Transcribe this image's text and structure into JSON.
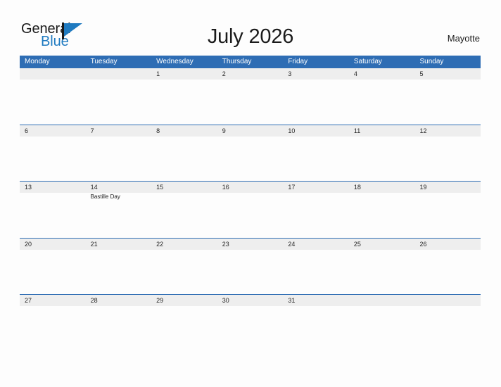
{
  "brand": {
    "name_part1": "General",
    "name_part2": "Blue",
    "flag_icon": "flag-icon",
    "color_primary": "#1f7ac0",
    "color_text": "#1b1b1b"
  },
  "header": {
    "title": "July 2026",
    "location": "Mayotte"
  },
  "theme": {
    "header_blue": "#2e6db4",
    "band_gray": "#eeeeee",
    "page_bg": "#fdfdfd",
    "text_dark": "#262626"
  },
  "calendar": {
    "month": "July",
    "year": "2026",
    "week_start": "Monday",
    "weekdays": [
      "Monday",
      "Tuesday",
      "Wednesday",
      "Thursday",
      "Friday",
      "Saturday",
      "Sunday"
    ],
    "weeks": [
      {
        "days": [
          {
            "num": "",
            "events": []
          },
          {
            "num": "",
            "events": []
          },
          {
            "num": "1",
            "events": []
          },
          {
            "num": "2",
            "events": []
          },
          {
            "num": "3",
            "events": []
          },
          {
            "num": "4",
            "events": []
          },
          {
            "num": "5",
            "events": []
          }
        ]
      },
      {
        "days": [
          {
            "num": "6",
            "events": []
          },
          {
            "num": "7",
            "events": []
          },
          {
            "num": "8",
            "events": []
          },
          {
            "num": "9",
            "events": []
          },
          {
            "num": "10",
            "events": []
          },
          {
            "num": "11",
            "events": []
          },
          {
            "num": "12",
            "events": []
          }
        ]
      },
      {
        "days": [
          {
            "num": "13",
            "events": []
          },
          {
            "num": "14",
            "events": [
              "Bastille Day"
            ]
          },
          {
            "num": "15",
            "events": []
          },
          {
            "num": "16",
            "events": []
          },
          {
            "num": "17",
            "events": []
          },
          {
            "num": "18",
            "events": []
          },
          {
            "num": "19",
            "events": []
          }
        ]
      },
      {
        "days": [
          {
            "num": "20",
            "events": []
          },
          {
            "num": "21",
            "events": []
          },
          {
            "num": "22",
            "events": []
          },
          {
            "num": "23",
            "events": []
          },
          {
            "num": "24",
            "events": []
          },
          {
            "num": "25",
            "events": []
          },
          {
            "num": "26",
            "events": []
          }
        ]
      },
      {
        "days": [
          {
            "num": "27",
            "events": []
          },
          {
            "num": "28",
            "events": []
          },
          {
            "num": "29",
            "events": []
          },
          {
            "num": "30",
            "events": []
          },
          {
            "num": "31",
            "events": []
          },
          {
            "num": "",
            "events": []
          },
          {
            "num": "",
            "events": []
          }
        ]
      }
    ]
  }
}
